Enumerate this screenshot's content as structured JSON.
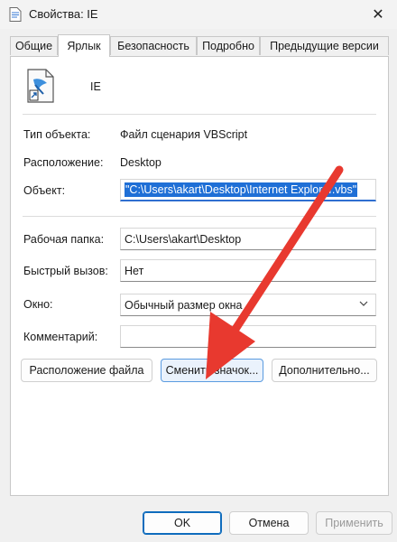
{
  "window": {
    "title": "Свойства: IE",
    "close_glyph": "✕"
  },
  "tabs": [
    {
      "label": "Общие"
    },
    {
      "label": "Ярлык"
    },
    {
      "label": "Безопасность"
    },
    {
      "label": "Подробно"
    },
    {
      "label": "Предыдущие версии"
    }
  ],
  "shortcut": {
    "name": "IE",
    "type_label": "Тип объекта:",
    "type_value": "Файл сценария VBScript",
    "location_label": "Расположение:",
    "location_value": "Desktop",
    "target_label": "Объект:",
    "target_value": "\"C:\\Users\\akart\\Desktop\\Internet Explorer.vbs\"",
    "workdir_label": "Рабочая папка:",
    "workdir_value": "C:\\Users\\akart\\Desktop",
    "hotkey_label": "Быстрый вызов:",
    "hotkey_value": "Нет",
    "window_label": "Окно:",
    "window_value": "Обычный размер окна",
    "comment_label": "Комментарий:",
    "comment_value": ""
  },
  "action_buttons": {
    "open_location": "Расположение файла",
    "change_icon": "Сменить значок...",
    "advanced": "Дополнительно..."
  },
  "footer": {
    "ok": "OK",
    "cancel": "Отмена",
    "apply": "Применить"
  },
  "colors": {
    "annotation_arrow": "#e8392f",
    "selection": "#1f6fd6",
    "accent": "#0f6cbd"
  }
}
